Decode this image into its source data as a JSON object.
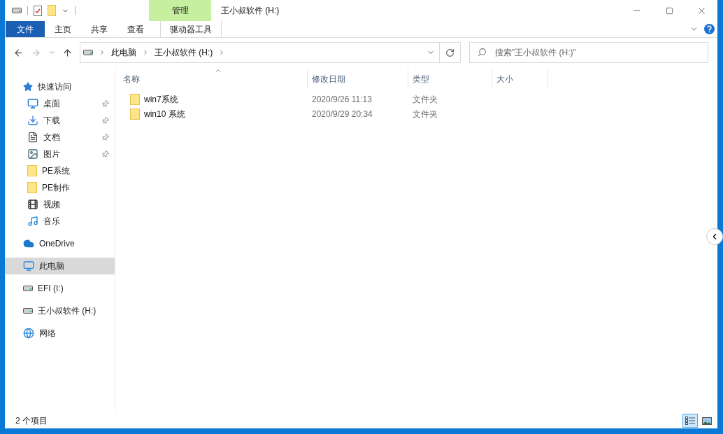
{
  "window": {
    "title": "王小叔软件 (H:)",
    "context_group": "管理"
  },
  "ribbon_tabs": [
    {
      "label": "文件",
      "kind": "file",
      "selected": false
    },
    {
      "label": "主页",
      "kind": "plain",
      "selected": false
    },
    {
      "label": "共享",
      "kind": "plain",
      "selected": false
    },
    {
      "label": "查看",
      "kind": "plain",
      "selected": false
    },
    {
      "label": "驱动器工具",
      "kind": "context",
      "selected": false
    }
  ],
  "breadcrumb": [
    "此电脑",
    "王小叔软件 (H:)"
  ],
  "search": {
    "placeholder": "搜索\"王小叔软件 (H:)\""
  },
  "sidebar": {
    "items": [
      {
        "label": "快速访问",
        "kind": "star",
        "selected": false,
        "children": [
          {
            "label": "桌面",
            "kind": "desktop",
            "pinned": true,
            "selected": false
          },
          {
            "label": "下载",
            "kind": "download",
            "pinned": true,
            "selected": false
          },
          {
            "label": "文档",
            "kind": "document",
            "pinned": true,
            "selected": false
          },
          {
            "label": "图片",
            "kind": "picture",
            "pinned": true,
            "selected": false
          },
          {
            "label": "PE系统",
            "kind": "folder",
            "pinned": false,
            "selected": false
          },
          {
            "label": "PE制作",
            "kind": "folder",
            "pinned": false,
            "selected": false
          },
          {
            "label": "视频",
            "kind": "video",
            "pinned": false,
            "selected": false
          },
          {
            "label": "音乐",
            "kind": "music",
            "pinned": false,
            "selected": false
          }
        ]
      },
      {
        "label": "OneDrive",
        "kind": "cloud",
        "selected": false
      },
      {
        "label": "此电脑",
        "kind": "pc",
        "selected": true
      },
      {
        "label": "EFI (I:)",
        "kind": "drive",
        "selected": false
      },
      {
        "label": "王小叔软件 (H:)",
        "kind": "drive",
        "selected": false
      },
      {
        "label": "网络",
        "kind": "network",
        "selected": false
      }
    ]
  },
  "table": {
    "columns": [
      "名称",
      "修改日期",
      "类型",
      "大小"
    ],
    "rows": [
      {
        "cells": [
          "win7系统",
          "2020/9/26 11:13",
          "文件夹"
        ]
      },
      {
        "cells": [
          "win10 系统",
          "2020/9/29 20:34",
          "文件夹"
        ]
      }
    ]
  },
  "status_bar": {
    "text": "2 个项目",
    "views": [
      {
        "kind": "details",
        "selected": true
      },
      {
        "kind": "thumbnails",
        "selected": false
      }
    ]
  }
}
